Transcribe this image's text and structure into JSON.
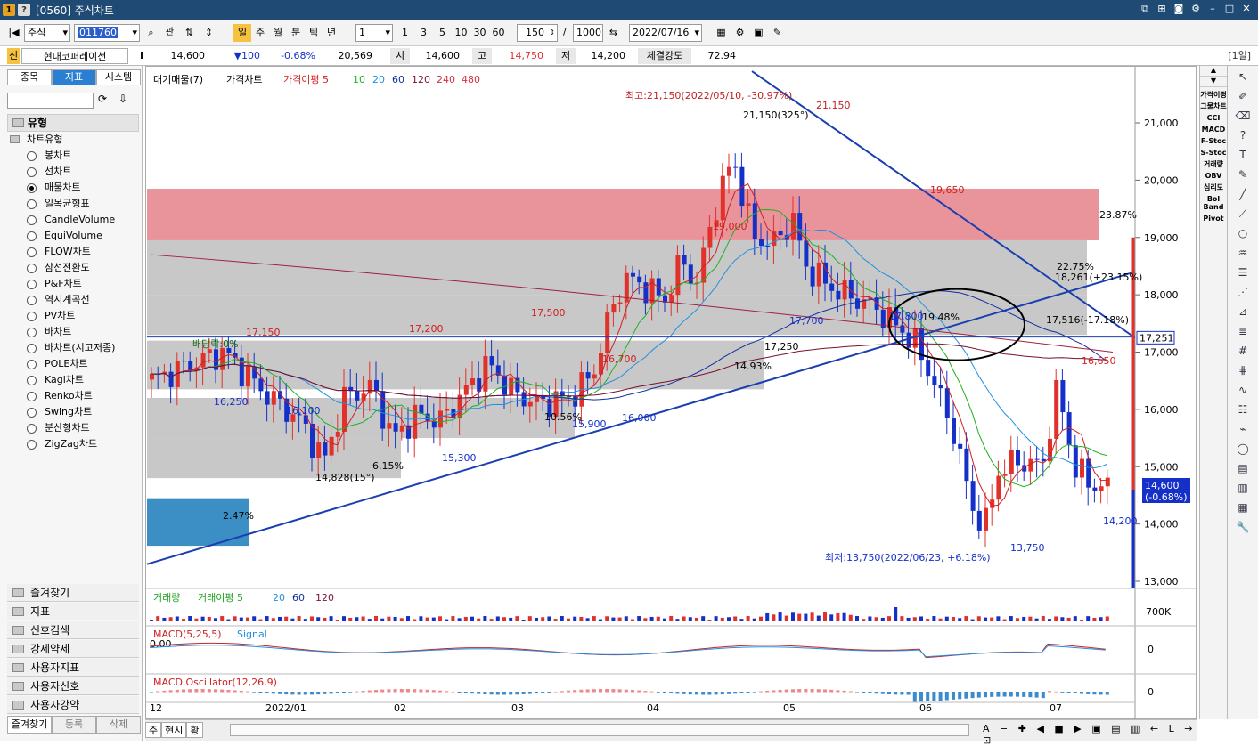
{
  "window": {
    "badge1": "1",
    "badge2": "?",
    "title": "[0560] 주식차트"
  },
  "toolbar": {
    "market": "주식",
    "code": "011760",
    "periods": [
      "일",
      "주",
      "월",
      "분",
      "틱",
      "년"
    ],
    "interval": "1",
    "quick_intervals": [
      "1",
      "3",
      "5",
      "10",
      "30",
      "60"
    ],
    "count": "150",
    "separator": "/",
    "max_count": "1000",
    "date": "2022/07/16"
  },
  "info": {
    "badge": "신",
    "name": "현대코퍼레이션",
    "i": "i",
    "price": "14,600",
    "change": "▼100",
    "rate": "-0.68%",
    "volume": "20,569",
    "open_label": "시",
    "open": "14,600",
    "high_label": "고",
    "high": "14,750",
    "low_label": "저",
    "low": "14,200",
    "strength_label": "체결강도",
    "strength": "72.94",
    "period": "[1일]"
  },
  "left": {
    "tabs": [
      "종목",
      "지표",
      "시스템"
    ],
    "section": "유형",
    "group": "차트유형",
    "items": [
      "봉차트",
      "선차트",
      "매물차트",
      "일목균형표",
      "CandleVolume",
      "EquiVolume",
      "FLOW차트",
      "삼선전환도",
      "P&F차트",
      "역시계곡선",
      "PV차트",
      "바차트",
      "바차트(시고저종)",
      "POLE차트",
      "Kagi차트",
      "Renko차트",
      "Swing차트",
      "분산형차트",
      "ZigZag차트"
    ],
    "selected_index": 2,
    "folders": [
      "즐겨찾기",
      "지표",
      "신호검색",
      "강세약세",
      "사용자지표",
      "사용자신호",
      "사용자강약"
    ],
    "bottom_tabs": [
      "즐겨찾기",
      "등록",
      "삭제"
    ]
  },
  "chart": {
    "legend": {
      "vp": "대기매물(7)",
      "price": "가격차트",
      "ma_label": "가격이평 5",
      "ma": [
        "10",
        "20",
        "60",
        "120",
        "240",
        "480"
      ]
    },
    "colors": {
      "up": "#e0312b",
      "down": "#1530c8",
      "ma5": "#d02020",
      "ma10": "#20b020",
      "ma20": "#2090e0",
      "ma60": "#1030a0",
      "ma120": "#7a1030",
      "ma240": "#a02040",
      "trend": "#1a3fb0"
    },
    "y_ticks": [
      "21,000",
      "20,000",
      "19,000",
      "18,000",
      "17,000",
      "16,000",
      "15,000",
      "14,000",
      "13,000"
    ],
    "x_ticks": [
      "12",
      "2022/01",
      "02",
      "03",
      "04",
      "05",
      "06",
      "07"
    ],
    "annotations": {
      "high_text": "최고:21,150(2022/05/10, -30.97%)",
      "high_price": "21,150",
      "high_angle": "21,150(325°)",
      "low_text": "최저:13,750(2022/06/23, +6.18%)",
      "low_price": "13,750",
      "pct": [
        "23.87%",
        "22.75%",
        "19.48%",
        "14.93%",
        "10.56%",
        "6.15%",
        "2.47%"
      ],
      "dividend": "배당락:0%",
      "angle_low": "14,828(15°)",
      "line_up": "18,261(+23.15%)",
      "line_down": "17,516(-17.18%)",
      "price_tag": "17,251",
      "cur_price": "14,600",
      "cur_rate": "(-0.68%)",
      "peaks_red": [
        "17,150",
        "17,200",
        "17,500",
        "19,000",
        "16,700",
        "19,650",
        "16,650",
        "21,150"
      ],
      "troughs_blue": [
        "16,250",
        "16,100",
        "15,300",
        "15,900",
        "16,000",
        "17,700",
        "17,800",
        "17,250",
        "14,200"
      ]
    },
    "vol_legend": {
      "v": "거래량",
      "ma": "거래이평 5",
      "l": [
        "20",
        "60",
        "120"
      ],
      "scale": "700K"
    },
    "macd_legend": {
      "name": "MACD(5,25,5)",
      "sig": "Signal",
      "zero": "0.00",
      "scale": "0"
    },
    "osc_legend": {
      "name": "MACD Oscillator(12,26,9)",
      "scale": "0"
    }
  },
  "rightbar": [
    "가격이평",
    "그물차트",
    "CCI",
    "MACD",
    "F-Stoc",
    "S-Stoc",
    "거래량",
    "OBV",
    "심리도",
    "Bol Band",
    "Pivot"
  ],
  "statusbar": {
    "tabs": [
      "주",
      "현시",
      "황"
    ]
  }
}
